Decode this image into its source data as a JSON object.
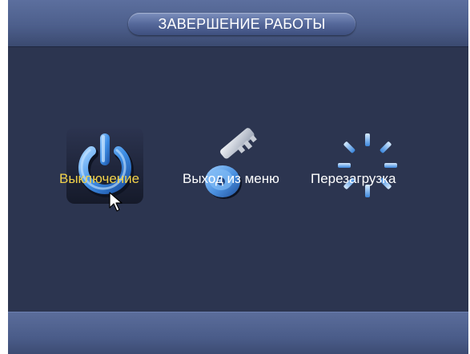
{
  "dialog": {
    "title": "ЗАВЕРШЕНИЕ РАБОТЫ"
  },
  "options": [
    {
      "label": "Выключение",
      "icon": "power-icon",
      "selected": true
    },
    {
      "label": "Выход из меню",
      "icon": "key-icon",
      "selected": false
    },
    {
      "label": "Перезагрузка",
      "icon": "reboot-icon",
      "selected": false
    }
  ],
  "colors": {
    "background": "#2c3550",
    "header": "#4d5f8c",
    "selected_label": "#f2d24a",
    "label": "#ffffff"
  }
}
